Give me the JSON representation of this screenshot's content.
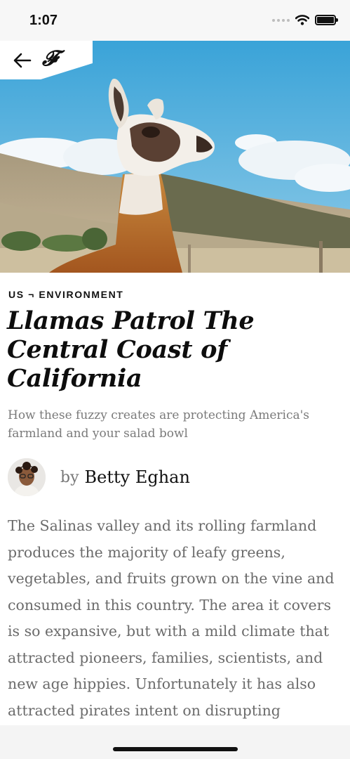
{
  "status_bar": {
    "time": "1:07",
    "icons": [
      "cellular-dots-icon",
      "wifi-icon",
      "battery-icon"
    ]
  },
  "nav": {
    "back_icon": "arrow-left-icon",
    "brand_logo": "𝓕"
  },
  "article": {
    "kicker": "US ¬ ENVIRONMENT",
    "title": "Llamas Patrol The Central Coast of California",
    "subtitle": "How these fuzzy creates are protecting America's farmland and your salad bowl",
    "byline_prefix": "by",
    "author": "Betty Eghan",
    "body": "The Salinas valley and its rolling farmland produces the majority of leafy greens, vegetables, and fruits grown on the vine and consumed in this country. The area it covers is so expansive, but with a mild climate that attracted pioneers, families, scientists, and new age hippies. Unfortunately it has also attracted pirates intent on disrupting"
  },
  "colors": {
    "sky": "#3fa9dd",
    "text_primary": "#111111",
    "text_muted": "#6b6b6b"
  }
}
